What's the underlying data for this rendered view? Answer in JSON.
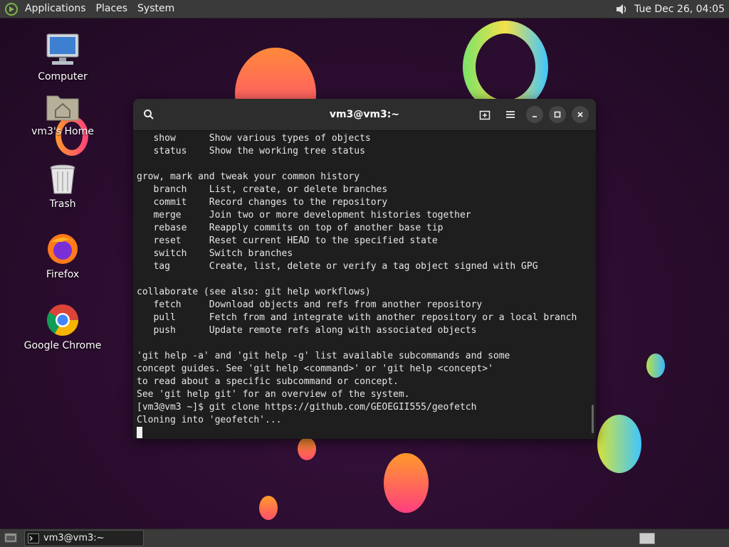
{
  "top_panel": {
    "menus": [
      "Applications",
      "Places",
      "System"
    ],
    "clock": "Tue Dec 26, 04:05"
  },
  "desktop_icons": [
    {
      "label": "Computer",
      "icon": "computer-icon"
    },
    {
      "label": "vm3's Home",
      "icon": "home-folder-icon"
    },
    {
      "label": "Trash",
      "icon": "trash-icon"
    },
    {
      "label": "Firefox",
      "icon": "firefox-icon"
    },
    {
      "label": "Google Chrome",
      "icon": "chrome-icon"
    }
  ],
  "terminal": {
    "title": "vm3@vm3:~",
    "lines": [
      "   show      Show various types of objects",
      "   status    Show the working tree status",
      "",
      "grow, mark and tweak your common history",
      "   branch    List, create, or delete branches",
      "   commit    Record changes to the repository",
      "   merge     Join two or more development histories together",
      "   rebase    Reapply commits on top of another base tip",
      "   reset     Reset current HEAD to the specified state",
      "   switch    Switch branches",
      "   tag       Create, list, delete or verify a tag object signed with GPG",
      "",
      "collaborate (see also: git help workflows)",
      "   fetch     Download objects and refs from another repository",
      "   pull      Fetch from and integrate with another repository or a local branch",
      "   push      Update remote refs along with associated objects",
      "",
      "'git help -a' and 'git help -g' list available subcommands and some",
      "concept guides. See 'git help <command>' or 'git help <concept>'",
      "to read about a specific subcommand or concept.",
      "See 'git help git' for an overview of the system.",
      "[vm3@vm3 ~]$ git clone https://github.com/GEOEGII555/geofetch",
      "Cloning into 'geofetch'..."
    ]
  },
  "taskbar": {
    "window_button": "vm3@vm3:~"
  },
  "colors": {
    "panel": "#3a3a3a",
    "terminal_bg": "#1e1e1e",
    "header_bg": "#2d2d2d"
  }
}
